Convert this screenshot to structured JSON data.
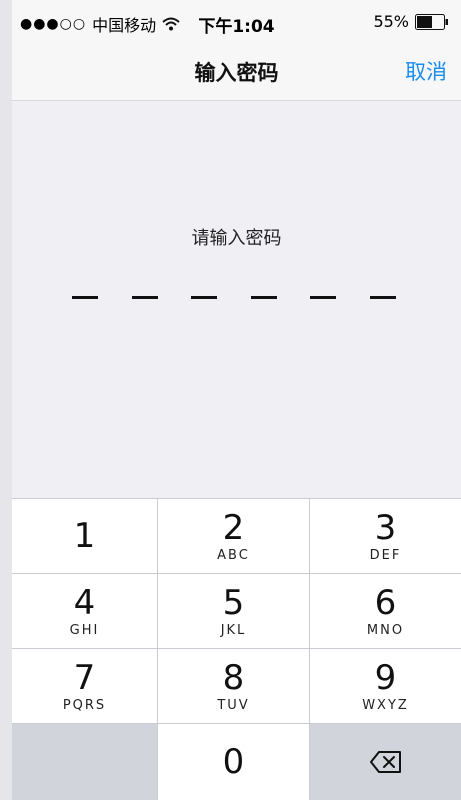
{
  "status_bar": {
    "signal": "●●●○○",
    "carrier": "中国移动",
    "time": "下午1:04",
    "battery": "55%"
  },
  "nav": {
    "title": "输入密码",
    "cancel_label": "取消"
  },
  "prompt": "请输入密码",
  "passcode": {
    "length": 6,
    "entered": 0
  },
  "keypad": {
    "keys": [
      {
        "digit": "1",
        "letters": ""
      },
      {
        "digit": "2",
        "letters": "ABC"
      },
      {
        "digit": "3",
        "letters": "DEF"
      },
      {
        "digit": "4",
        "letters": "GHI"
      },
      {
        "digit": "5",
        "letters": "JKL"
      },
      {
        "digit": "6",
        "letters": "MNO"
      },
      {
        "digit": "7",
        "letters": "PQRS"
      },
      {
        "digit": "8",
        "letters": "TUV"
      },
      {
        "digit": "9",
        "letters": "WXYZ"
      },
      {
        "digit": "0",
        "letters": ""
      }
    ],
    "delete_icon": "backspace-icon"
  },
  "colors": {
    "accent": "#1a8cf0",
    "background": "#efeff4",
    "key_bg": "#ffffff",
    "keypad_separator": "#c9ccd2"
  }
}
